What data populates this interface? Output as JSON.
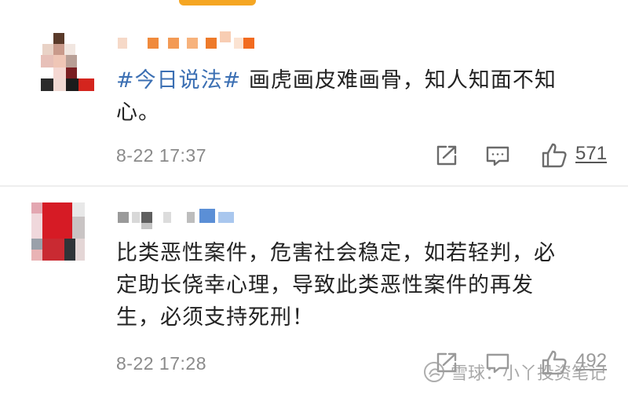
{
  "comments": [
    {
      "hashtag": "#今日说法#",
      "text_line1": " 画虎画皮难画骨，知人知面不知",
      "text_line2": "心。",
      "time": "8-22 17:37",
      "likes": "571"
    },
    {
      "text_line1": "比类恶性案件，危害社会稳定，如若轻判，必",
      "text_line2": "定助长侥幸心理，导致此类恶性案件的再发",
      "text_line3": "生，必须支持死刑！",
      "time": "8-22 17:28",
      "likes": "492"
    }
  ],
  "watermark": {
    "text": "雪球：小丫投资笔记"
  },
  "icons": {
    "share": "share-icon",
    "comment": "comment-icon",
    "like": "thumbs-up-icon",
    "watermark": "snowball-logo-icon"
  },
  "colors": {
    "hashtag": "#3b6fb3",
    "accent": "#f5a623",
    "meta": "#8a8a8a"
  }
}
